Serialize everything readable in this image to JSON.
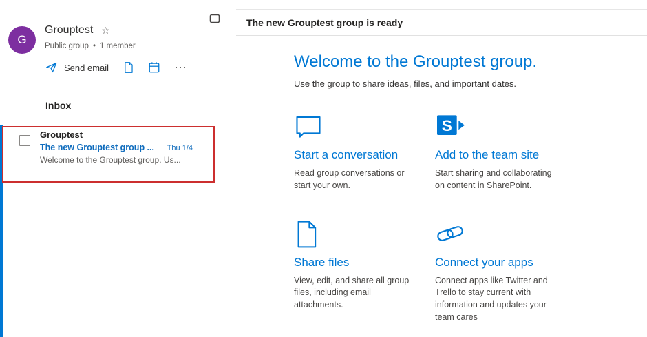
{
  "colors": {
    "accent": "#0078d4",
    "avatar_purple": "#7d2ea0",
    "link_blue": "#0f6cbd",
    "annotation_red": "#cc2f2f"
  },
  "sidebar": {
    "avatar_letter": "G",
    "group_name": "Grouptest",
    "group_type": "Public group",
    "member_count": "1 member",
    "send_email_label": "Send email",
    "more_label": "⋯",
    "inbox_label": "Inbox",
    "email": {
      "sender": "Grouptest",
      "subject": "The new Grouptest group ...",
      "date": "Thu 1/4",
      "preview": "Welcome to the Grouptest group. Us..."
    }
  },
  "main": {
    "header_title": "The new Grouptest group is ready",
    "welcome_title": "Welcome to the Grouptest group.",
    "welcome_subtitle": "Use the group to share ideas, files, and important dates.",
    "features": [
      {
        "icon": "comment-icon",
        "title": "Start a conversation",
        "description": "Read group conversations or start your own."
      },
      {
        "icon": "sharepoint-icon",
        "title": "Add to the team site",
        "description": "Start sharing and collaborating on content in SharePoint."
      },
      {
        "icon": "file-icon",
        "title": "Share files",
        "description": "View, edit, and share all group files, including email attachments."
      },
      {
        "icon": "link-icon",
        "title": "Connect your apps",
        "description": "Connect apps like Twitter and Trello to stay current with information and updates your team cares"
      }
    ]
  }
}
